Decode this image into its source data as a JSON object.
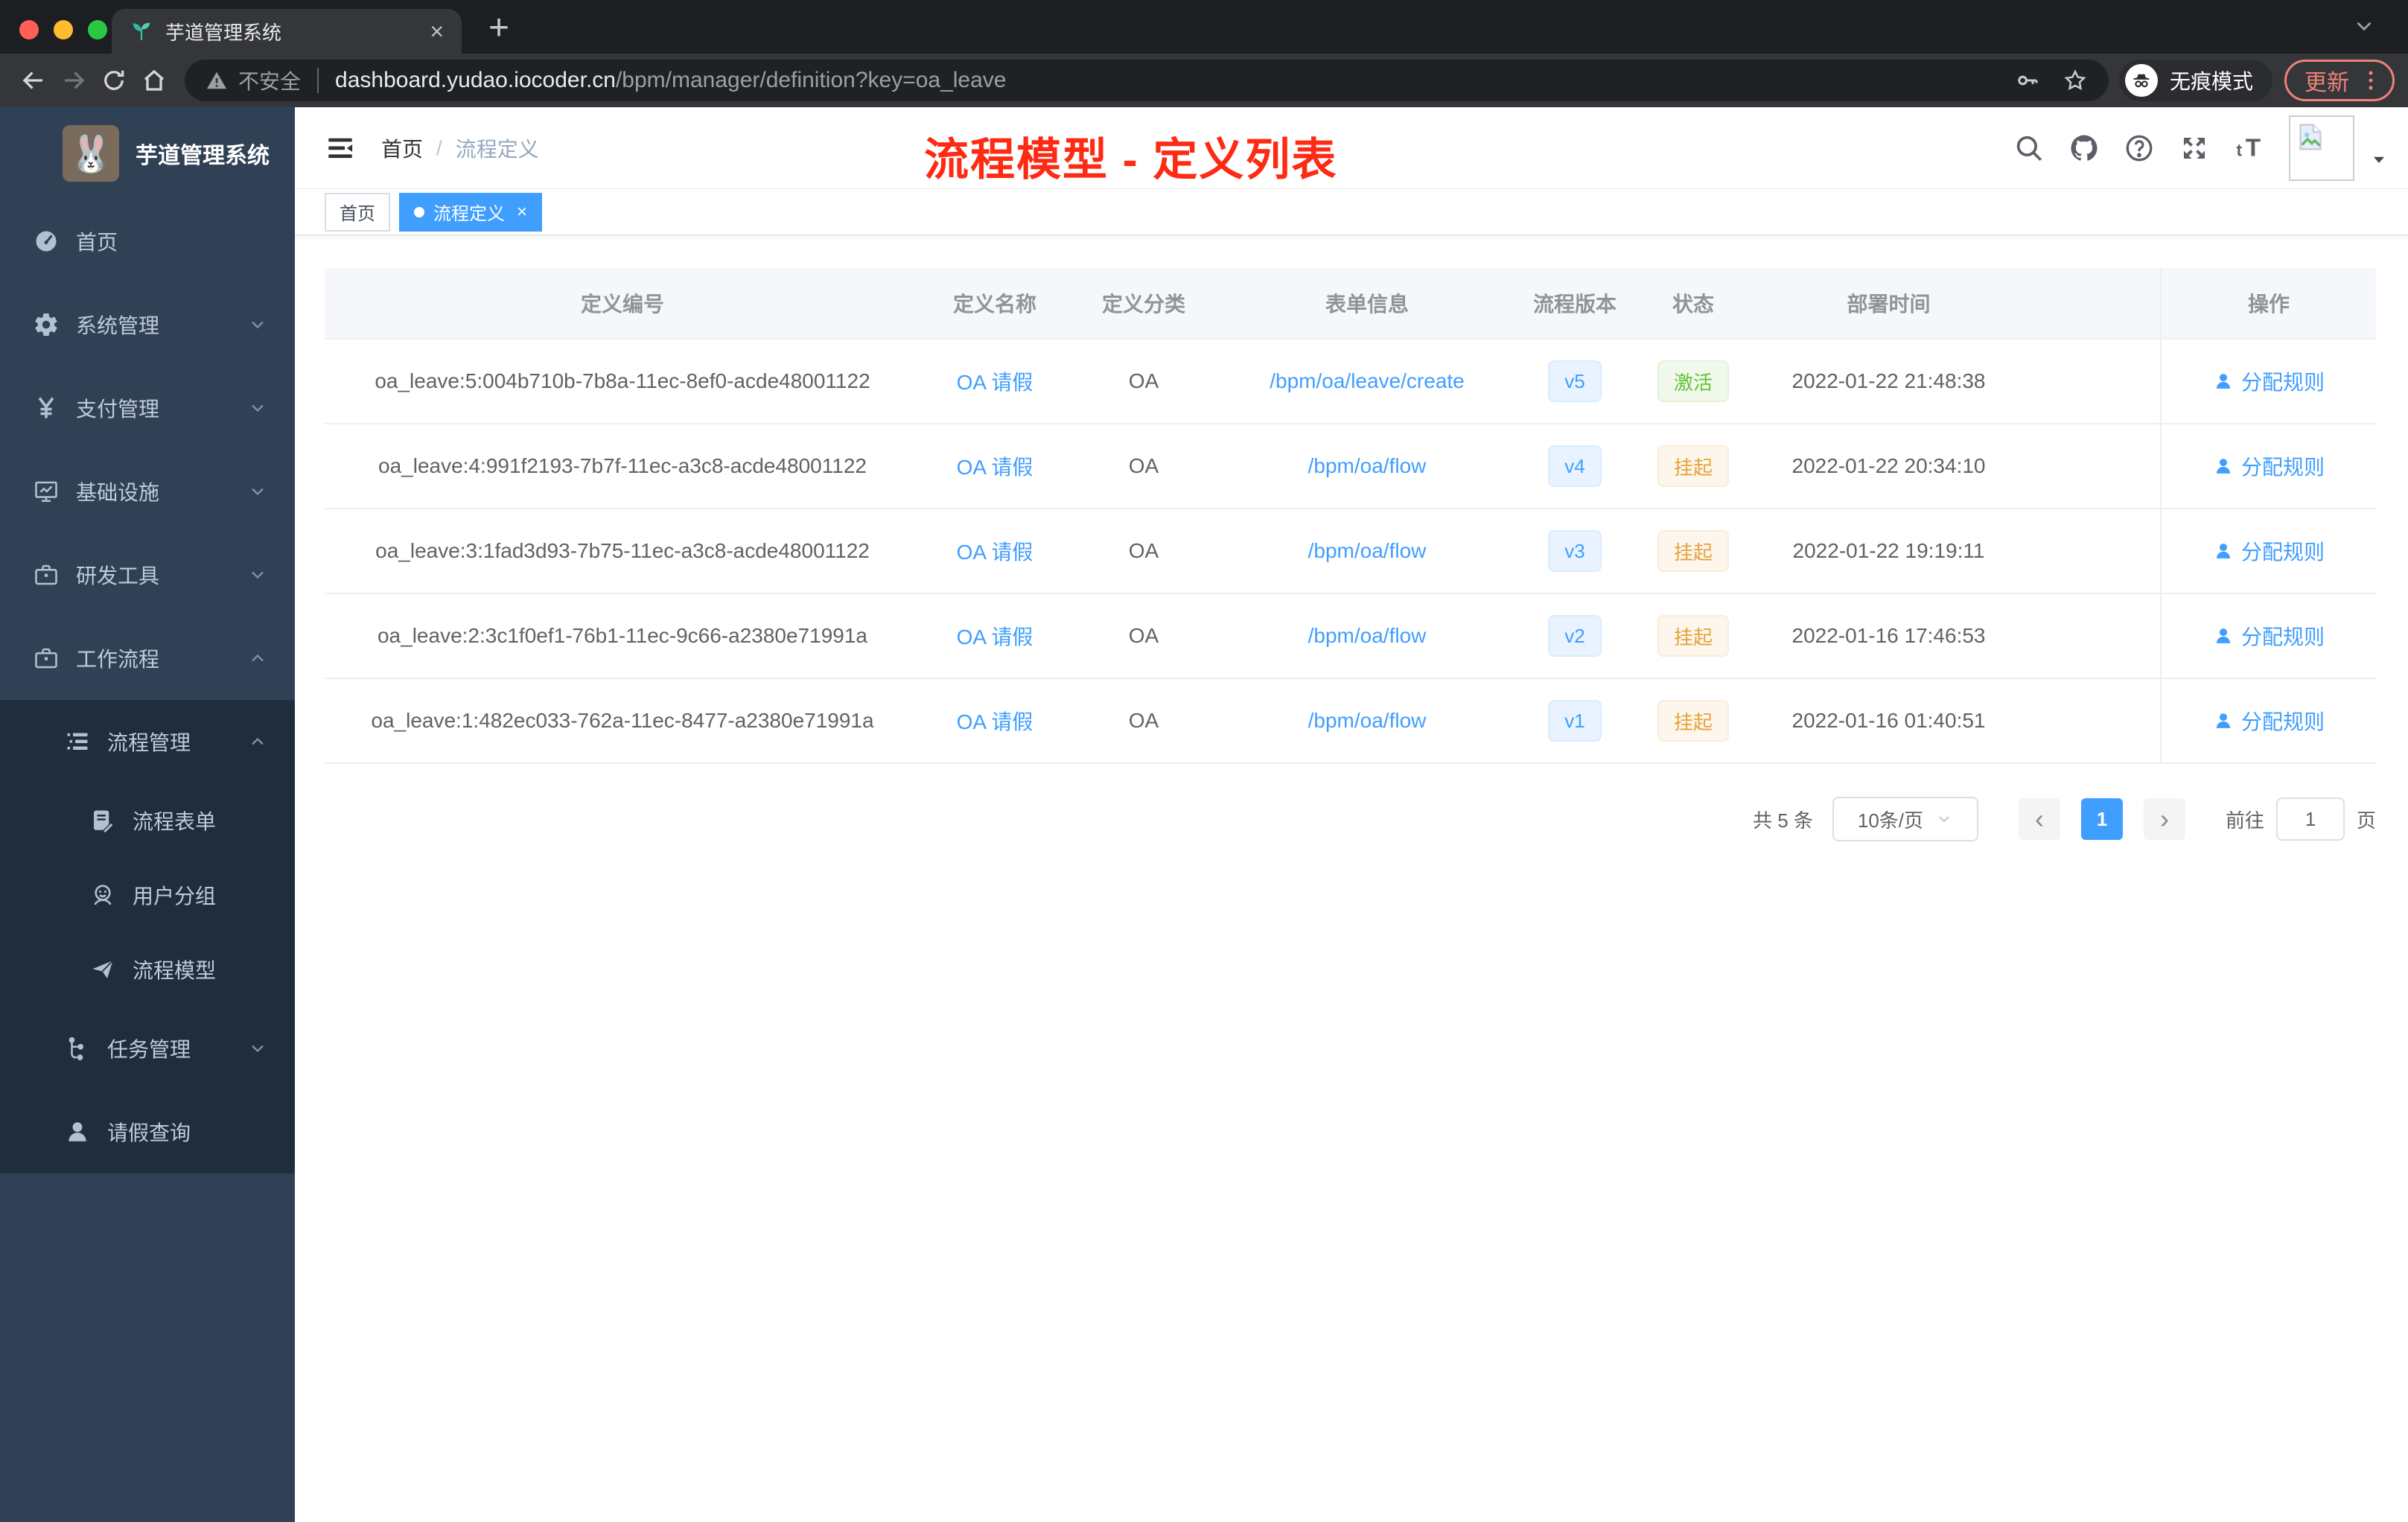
{
  "browser": {
    "tab_title": "芋道管理系统",
    "security_label": "不安全",
    "url_host": "dashboard.yudao.iocoder.cn",
    "url_path": "/bpm/manager/definition?key=oa_leave",
    "incognito_label": "无痕模式",
    "update_label": "更新",
    "traffic_colors": {
      "close": "#ff5f57",
      "minimize": "#febc2e",
      "zoom": "#28c840"
    }
  },
  "sidebar": {
    "logo_title": "芋道管理系统",
    "items": [
      {
        "label": "首页",
        "icon": "dashboard-icon",
        "indent": 0,
        "chevron": null,
        "dark": false
      },
      {
        "label": "系统管理",
        "icon": "gear-icon",
        "indent": 0,
        "chevron": "down",
        "dark": false
      },
      {
        "label": "支付管理",
        "icon": "yen-icon",
        "indent": 0,
        "chevron": "down",
        "dark": false
      },
      {
        "label": "基础设施",
        "icon": "monitor-icon",
        "indent": 0,
        "chevron": "down",
        "dark": false
      },
      {
        "label": "研发工具",
        "icon": "briefcase-icon",
        "indent": 0,
        "chevron": "down",
        "dark": false
      },
      {
        "label": "工作流程",
        "icon": "briefcase-icon",
        "indent": 0,
        "chevron": "up",
        "dark": false
      },
      {
        "label": "流程管理",
        "icon": "tree-table-icon",
        "indent": 1,
        "chevron": "up",
        "dark": true
      },
      {
        "label": "流程表单",
        "icon": "form-icon",
        "indent": 2,
        "chevron": null,
        "dark": true
      },
      {
        "label": "用户分组",
        "icon": "people-icon",
        "indent": 2,
        "chevron": null,
        "dark": true
      },
      {
        "label": "流程模型",
        "icon": "send-icon",
        "indent": 2,
        "chevron": null,
        "dark": true
      },
      {
        "label": "任务管理",
        "icon": "tree-icon",
        "indent": 1,
        "chevron": "down",
        "dark": true
      },
      {
        "label": "请假查询",
        "icon": "user-icon",
        "indent": 1,
        "chevron": null,
        "dark": true
      }
    ]
  },
  "header": {
    "breadcrumb": [
      "首页",
      "流程定义"
    ],
    "breadcrumb_separator": "/",
    "annotation": "流程模型 - 定义列表",
    "right_icons": [
      "search-icon",
      "github-icon",
      "question-icon",
      "fullscreen-icon",
      "font-size-icon"
    ]
  },
  "tags": [
    {
      "label": "首页",
      "active": false
    },
    {
      "label": "流程定义",
      "active": true
    }
  ],
  "table": {
    "columns": [
      "定义编号",
      "定义名称",
      "定义分类",
      "表单信息",
      "流程版本",
      "状态",
      "部署时间",
      "操作"
    ],
    "action_label": "分配规则",
    "rows": [
      {
        "id": "oa_leave:5:004b710b-7b8a-11ec-8ef0-acde48001122",
        "name": "OA 请假",
        "category": "OA",
        "form": "/bpm/oa/leave/create",
        "version": "v5",
        "status": "激活",
        "status_type": "success",
        "deploy_time": "2022-01-22 21:48:38"
      },
      {
        "id": "oa_leave:4:991f2193-7b7f-11ec-a3c8-acde48001122",
        "name": "OA 请假",
        "category": "OA",
        "form": "/bpm/oa/flow",
        "version": "v4",
        "status": "挂起",
        "status_type": "warning",
        "deploy_time": "2022-01-22 20:34:10"
      },
      {
        "id": "oa_leave:3:1fad3d93-7b75-11ec-a3c8-acde48001122",
        "name": "OA 请假",
        "category": "OA",
        "form": "/bpm/oa/flow",
        "version": "v3",
        "status": "挂起",
        "status_type": "warning",
        "deploy_time": "2022-01-22 19:19:11"
      },
      {
        "id": "oa_leave:2:3c1f0ef1-76b1-11ec-9c66-a2380e71991a",
        "name": "OA 请假",
        "category": "OA",
        "form": "/bpm/oa/flow",
        "version": "v2",
        "status": "挂起",
        "status_type": "warning",
        "deploy_time": "2022-01-16 17:46:53"
      },
      {
        "id": "oa_leave:1:482ec033-762a-11ec-8477-a2380e71991a",
        "name": "OA 请假",
        "category": "OA",
        "form": "/bpm/oa/flow",
        "version": "v1",
        "status": "挂起",
        "status_type": "warning",
        "deploy_time": "2022-01-16 01:40:51"
      }
    ]
  },
  "pagination": {
    "total_label": "共 5 条",
    "page_size": "10条/页",
    "prev_glyph": "‹",
    "next_glyph": "›",
    "current_page": "1",
    "goto_label": "前往",
    "goto_value": "1",
    "page_label": "页"
  },
  "colors": {
    "accent": "#409eff",
    "success": "#67c23a",
    "warning": "#e6a23c",
    "sidebar_bg": "#304156",
    "sidebar_sub_bg": "#1f2d3d",
    "annotation_red": "#fe2b14"
  }
}
